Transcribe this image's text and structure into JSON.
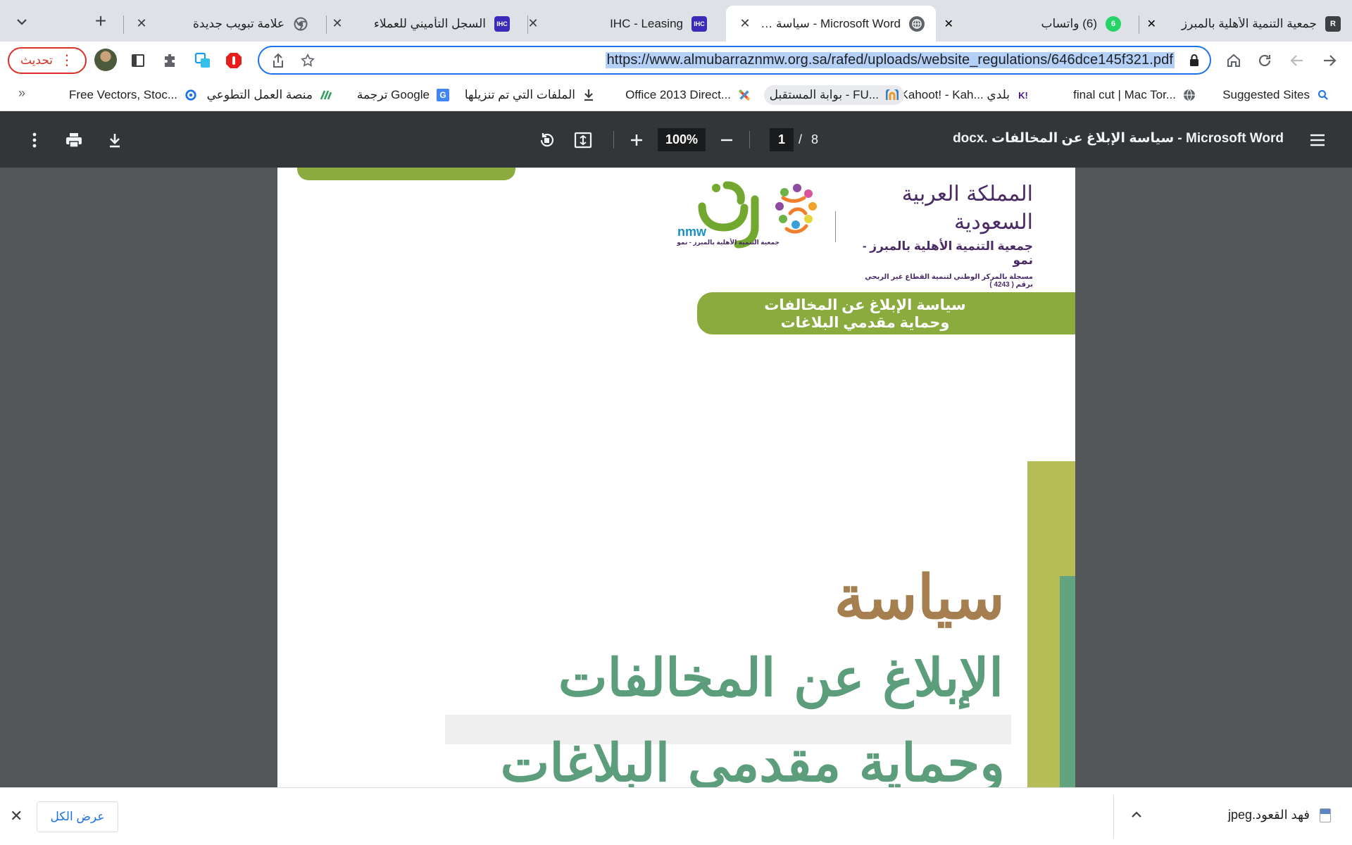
{
  "tabs": [
    {
      "title": "جمعية التنمية الأهلية بالمبرز",
      "favicon": "R",
      "favicon_color": "#3c4043",
      "active": false
    },
    {
      "title": "(6) واتساب",
      "favicon": "6",
      "favicon_color": "#25d366",
      "active": false
    },
    {
      "title": "Microsoft Word - سياسة الإبلاغ عن المخالفات",
      "favicon": "globe",
      "favicon_color": "#5f6368",
      "active": true
    },
    {
      "title": "IHC - Leasing",
      "favicon": "IHC",
      "favicon_color": "#3a2bb8",
      "active": false
    },
    {
      "title": "السجل التأميني للعملاء",
      "favicon": "IHC",
      "favicon_color": "#3a2bb8",
      "active": false
    },
    {
      "title": "علامة تبويب جديدة",
      "favicon": "chrome",
      "favicon_color": "#5f6368",
      "active": false
    }
  ],
  "toolbar": {
    "url": "https://www.almubarraznmw.org.sa/rafed/uploads/website_regulations/646dce145f321.pdf",
    "update_label": "تحديث"
  },
  "bookmarks": [
    {
      "label": "Suggested Sites",
      "icon": "search-icon"
    },
    {
      "label": "final cut | Mac Tor...",
      "icon": "globe-icon"
    },
    {
      "label": "Kahoot! - Kah... بلدي",
      "icon": "kahoot-icon"
    },
    {
      "label": "بوابة المستقبل - FU...",
      "icon": "portal-icon"
    },
    {
      "label": "Office 2013 Direct...",
      "icon": "joomla-icon"
    },
    {
      "label": "الملفات التي تم تنزيلها",
      "icon": "download-icon"
    },
    {
      "label": "ترجمة Google",
      "icon": "translate-icon"
    },
    {
      "label": "منصة العمل التطوعي",
      "icon": "volunteer-icon"
    },
    {
      "label": "Free Vectors, Stoc...",
      "icon": "vector-icon"
    }
  ],
  "bookmarks_more": "»",
  "pdf": {
    "title": "Microsoft Word - سياسة الإبلاغ عن المخالفات .docx",
    "zoom": "100%",
    "page": "1",
    "separator": "/",
    "total_pages": "8"
  },
  "document": {
    "crest_script": "المملكة العربية السعودية",
    "org_name": "جمعية التنمية الأهلية بالمبرز - نمو",
    "registration": "مسجلة بالمركز الوطني لتنمية القطاع غير الربحي برقم ( 4243 )",
    "namaa_ar": "نمو",
    "namaa_en": "nmw",
    "namaa_sub": "جمعية التنمية الأهلية بالمبرز - نمو",
    "ribbon_line1": "سياسة الإبلاغ عن المخالفات",
    "ribbon_line2": "وحماية مقدمي البلاغات",
    "heading_1": "سياسة",
    "heading_2": "الإبلاغ عن المخالفات",
    "heading_3": "وحماية مقدمي البلاغات"
  },
  "downloads": {
    "show_all": "عرض الكل",
    "file_name": "فهد القعود.jpeg"
  },
  "colors": {
    "accent": "#1a73e8",
    "brand_green": "#8bab3e",
    "heading_brown": "#a57f4f",
    "heading_teal": "#5c9e7c",
    "update_red": "#d93025"
  }
}
